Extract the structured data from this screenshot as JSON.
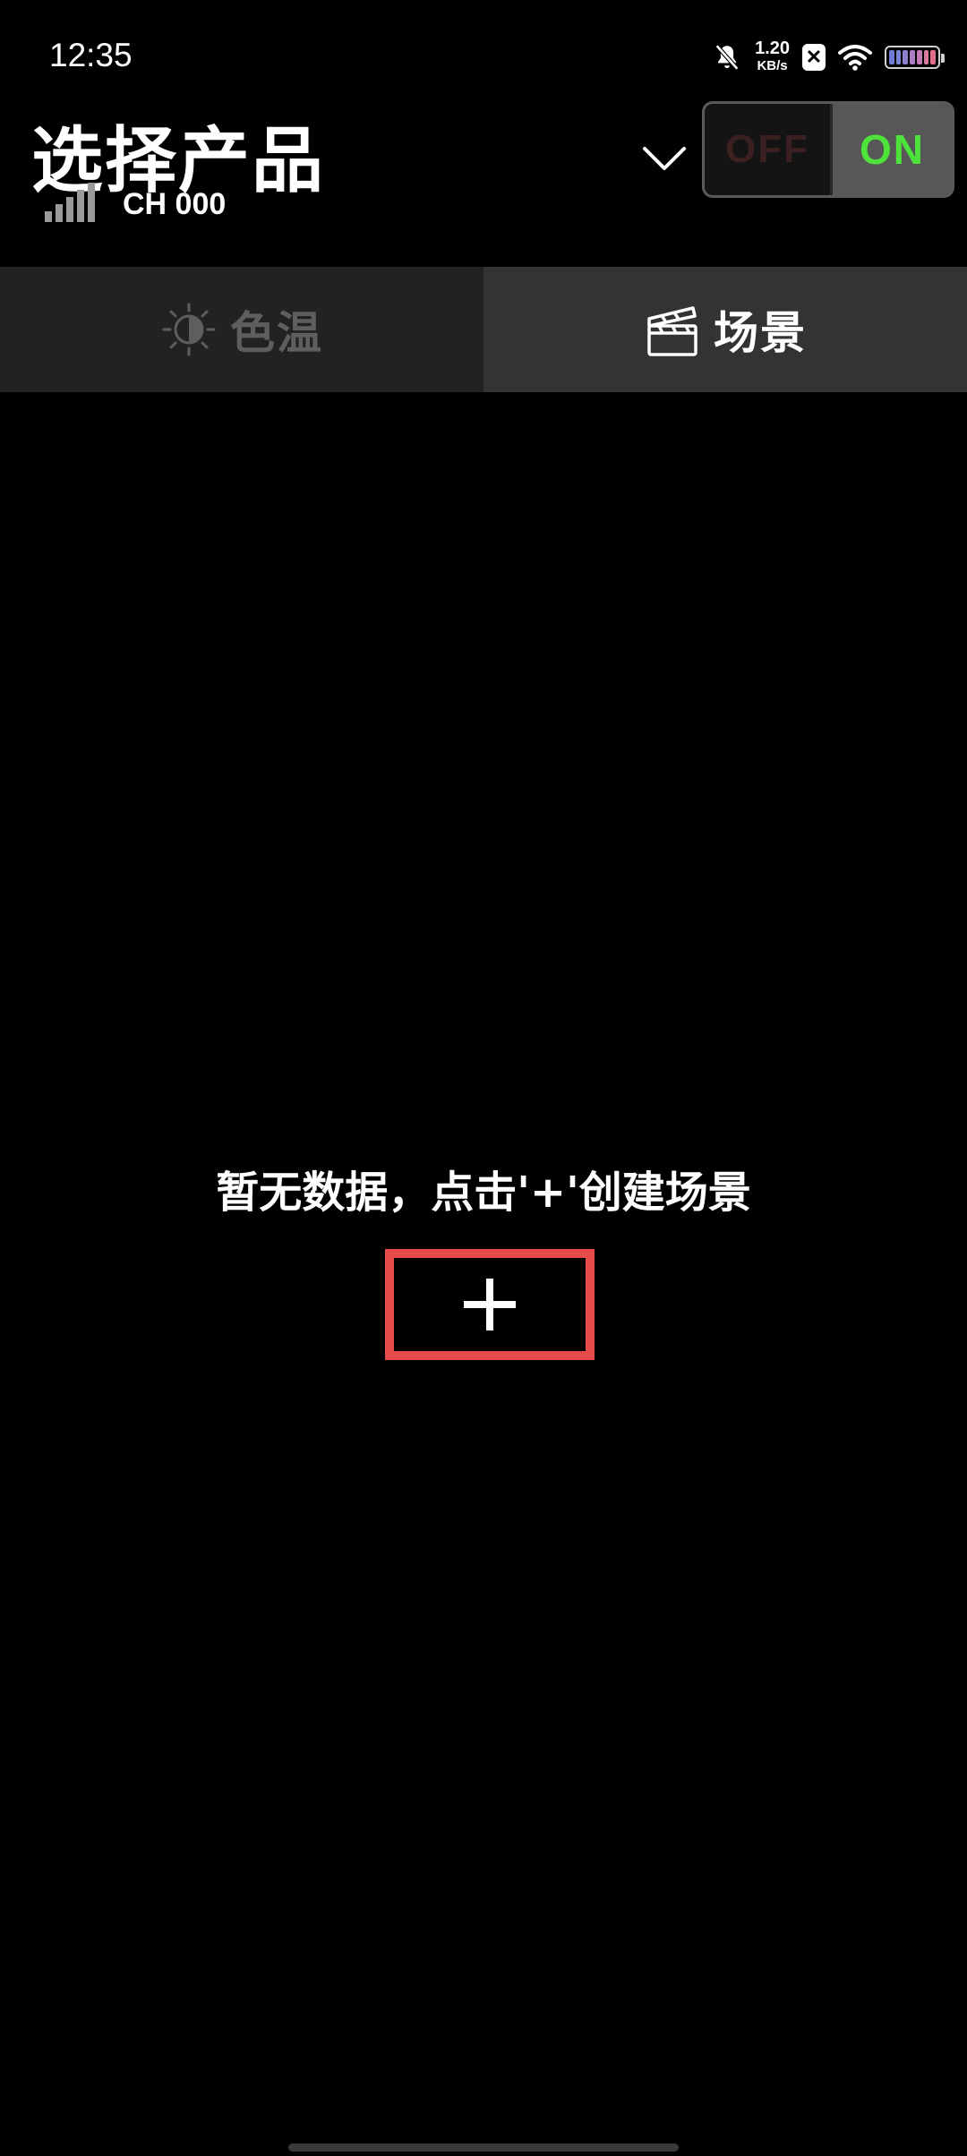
{
  "status_bar": {
    "time": "12:35",
    "net_speed_value": "1.20",
    "net_speed_unit": "KB/s",
    "icons": [
      "bell-off-icon",
      "notification-x-icon",
      "wifi-icon",
      "battery-icon"
    ],
    "battery_colors": [
      "#6f7cd8",
      "#7a82d6",
      "#8f7fcf",
      "#a97ec3",
      "#c07bb3",
      "#d47a9c",
      "#e0708a"
    ]
  },
  "header": {
    "title": "选择产品",
    "channel": "CH 000",
    "signal_icon": "signal-bars-icon",
    "dropdown_icon": "chevron-down-icon",
    "power": {
      "off_label": "OFF",
      "on_label": "ON",
      "state": "ON",
      "on_color": "#4ee33a"
    }
  },
  "tabs": [
    {
      "label": "色温",
      "icon": "brightness-icon",
      "active": false
    },
    {
      "label": "场景",
      "icon": "clapperboard-icon",
      "active": true
    }
  ],
  "main": {
    "empty_message": "暂无数据，点击'+'创建场景",
    "add_button_icon": "plus-icon",
    "add_button_border_color": "#e64b49"
  }
}
